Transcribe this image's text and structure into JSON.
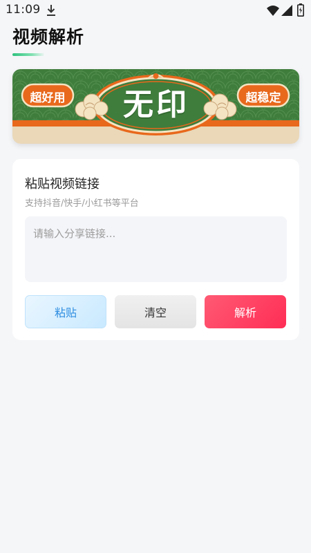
{
  "status_bar": {
    "time": "11:09",
    "icons": [
      "download-icon",
      "wifi-icon",
      "signal-icon",
      "battery-icon"
    ]
  },
  "header": {
    "title": "视频解析"
  },
  "banner": {
    "left_badge": "超好用",
    "center_text": "无印",
    "right_badge": "超稳定"
  },
  "card": {
    "title": "粘贴视频链接",
    "subtitle": "支持抖音/快手/小红书等平台",
    "input": {
      "value": "",
      "placeholder": "请输入分享链接..."
    },
    "buttons": {
      "paste": "粘贴",
      "clear": "清空",
      "parse": "解析"
    }
  },
  "colors": {
    "background": "#f5f6f8",
    "banner_green": "#3f7d3c",
    "banner_orange": "#e8681c",
    "banner_cream": "#ead8b8",
    "primary_red": "#ff2d55",
    "paste_blue": "#2e8de0",
    "accent_green": "#2ec27e"
  }
}
